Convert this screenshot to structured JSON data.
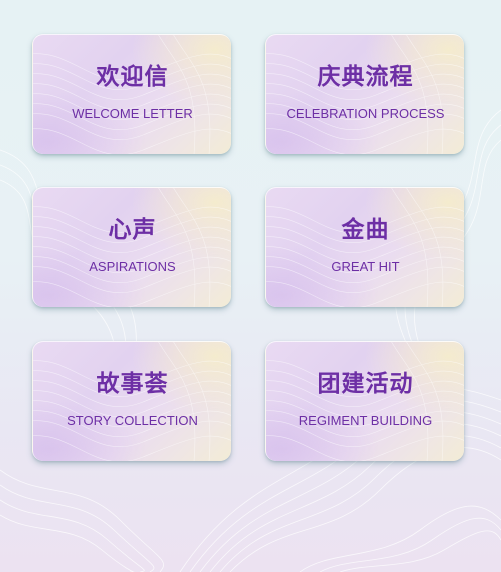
{
  "colors": {
    "text_accent": "#6d2fa5",
    "card_tint": "#e4d4f1",
    "background": "#e6f2f4"
  },
  "menu": {
    "items": [
      {
        "title": "欢迎信",
        "subtitle": "WELCOME LETTER"
      },
      {
        "title": "庆典流程",
        "subtitle": "CELEBRATION PROCESS"
      },
      {
        "title": "心声",
        "subtitle": "ASPIRATIONS"
      },
      {
        "title": "金曲",
        "subtitle": "GREAT HIT"
      },
      {
        "title": "故事荟",
        "subtitle": "STORY COLLECTION"
      },
      {
        "title": "团建活动",
        "subtitle": "REGIMENT BUILDING"
      }
    ]
  }
}
